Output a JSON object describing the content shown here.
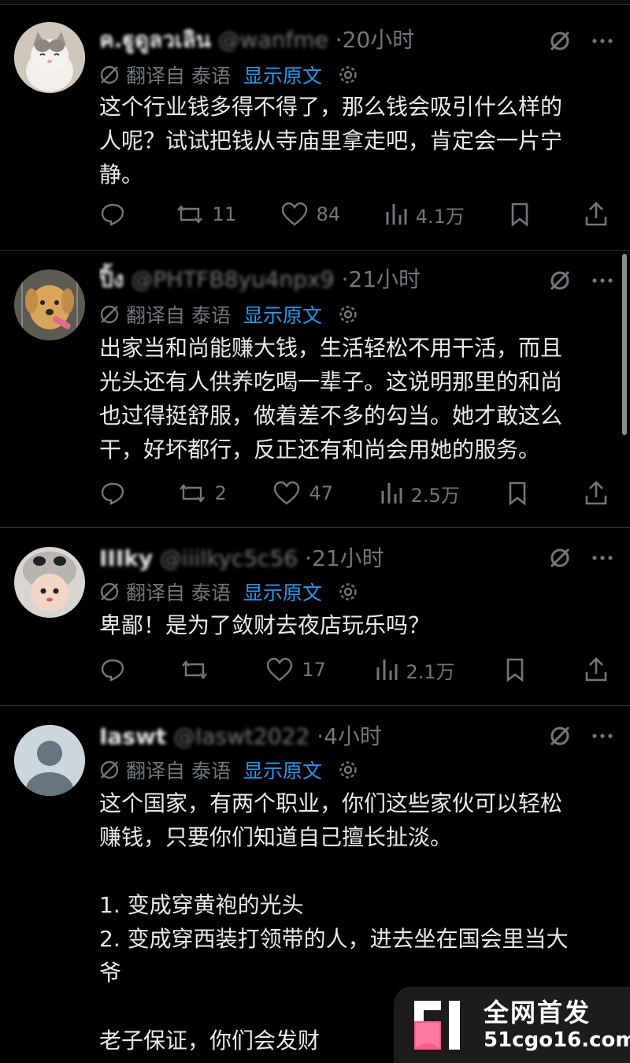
{
  "translate_label": "翻译自 泰语",
  "show_original": "显示原文",
  "tweets": [
    {
      "name": "ค.ฐูดูลวเลิน",
      "handle": "@wanfme",
      "time": "·20小时",
      "body": "这个行业钱多得不得了，那么钱会吸引什么样的\n人呢？试试把钱从寺庙里拿走吧，肯定会一片宁\n静。",
      "retweets": "11",
      "likes": "84",
      "views": "4.1万",
      "avatar": "cat"
    },
    {
      "name": "ปิ้ง",
      "handle": "@PHTFB8yu4npx9",
      "time": "·21小时",
      "body": "出家当和尚能赚大钱，生活轻松不用干活，而且\n光头还有人供养吃喝一辈子。这说明那里的和尚\n也过得挺舒服，做着差不多的勾当。她才敢这么\n干，好坏都行，反正还有和尚会用她的服务。",
      "retweets": "2",
      "likes": "47",
      "views": "2.5万",
      "avatar": "dog"
    },
    {
      "name": "IIIky",
      "handle": "@iiilkyc5c56",
      "time": "·21小时",
      "body": "卑鄙！是为了敛财去夜店玩乐吗？",
      "retweets": "",
      "likes": "17",
      "views": "2.1万",
      "avatar": "kid"
    },
    {
      "name": "Iaswt",
      "handle": "@Iaswt2022",
      "time": "·4小时",
      "body": "这个国家，有两个职业，你们这些家伙可以轻松\n赚钱，只要你们知道自己擅长扯淡。\n\n1. 变成穿黄袍的光头\n2. 变成穿西装打领带的人，进去坐在国会里当大\n爷\n\n老子保证，你们会发财",
      "avatar": "default"
    }
  ],
  "watermark": {
    "line1": "全网首发",
    "line2": "51cgo16.com"
  },
  "colors": {
    "background": "#000000",
    "text": "#e7e9ea",
    "muted": "#71767b",
    "link": "#1d9bf0",
    "divider": "#2f3336"
  },
  "icons": [
    "grok-icon",
    "more-icon",
    "translate-globe-icon",
    "settings-gear-icon",
    "reply-icon",
    "retweet-icon",
    "like-icon",
    "views-icon",
    "bookmark-icon",
    "share-icon"
  ]
}
